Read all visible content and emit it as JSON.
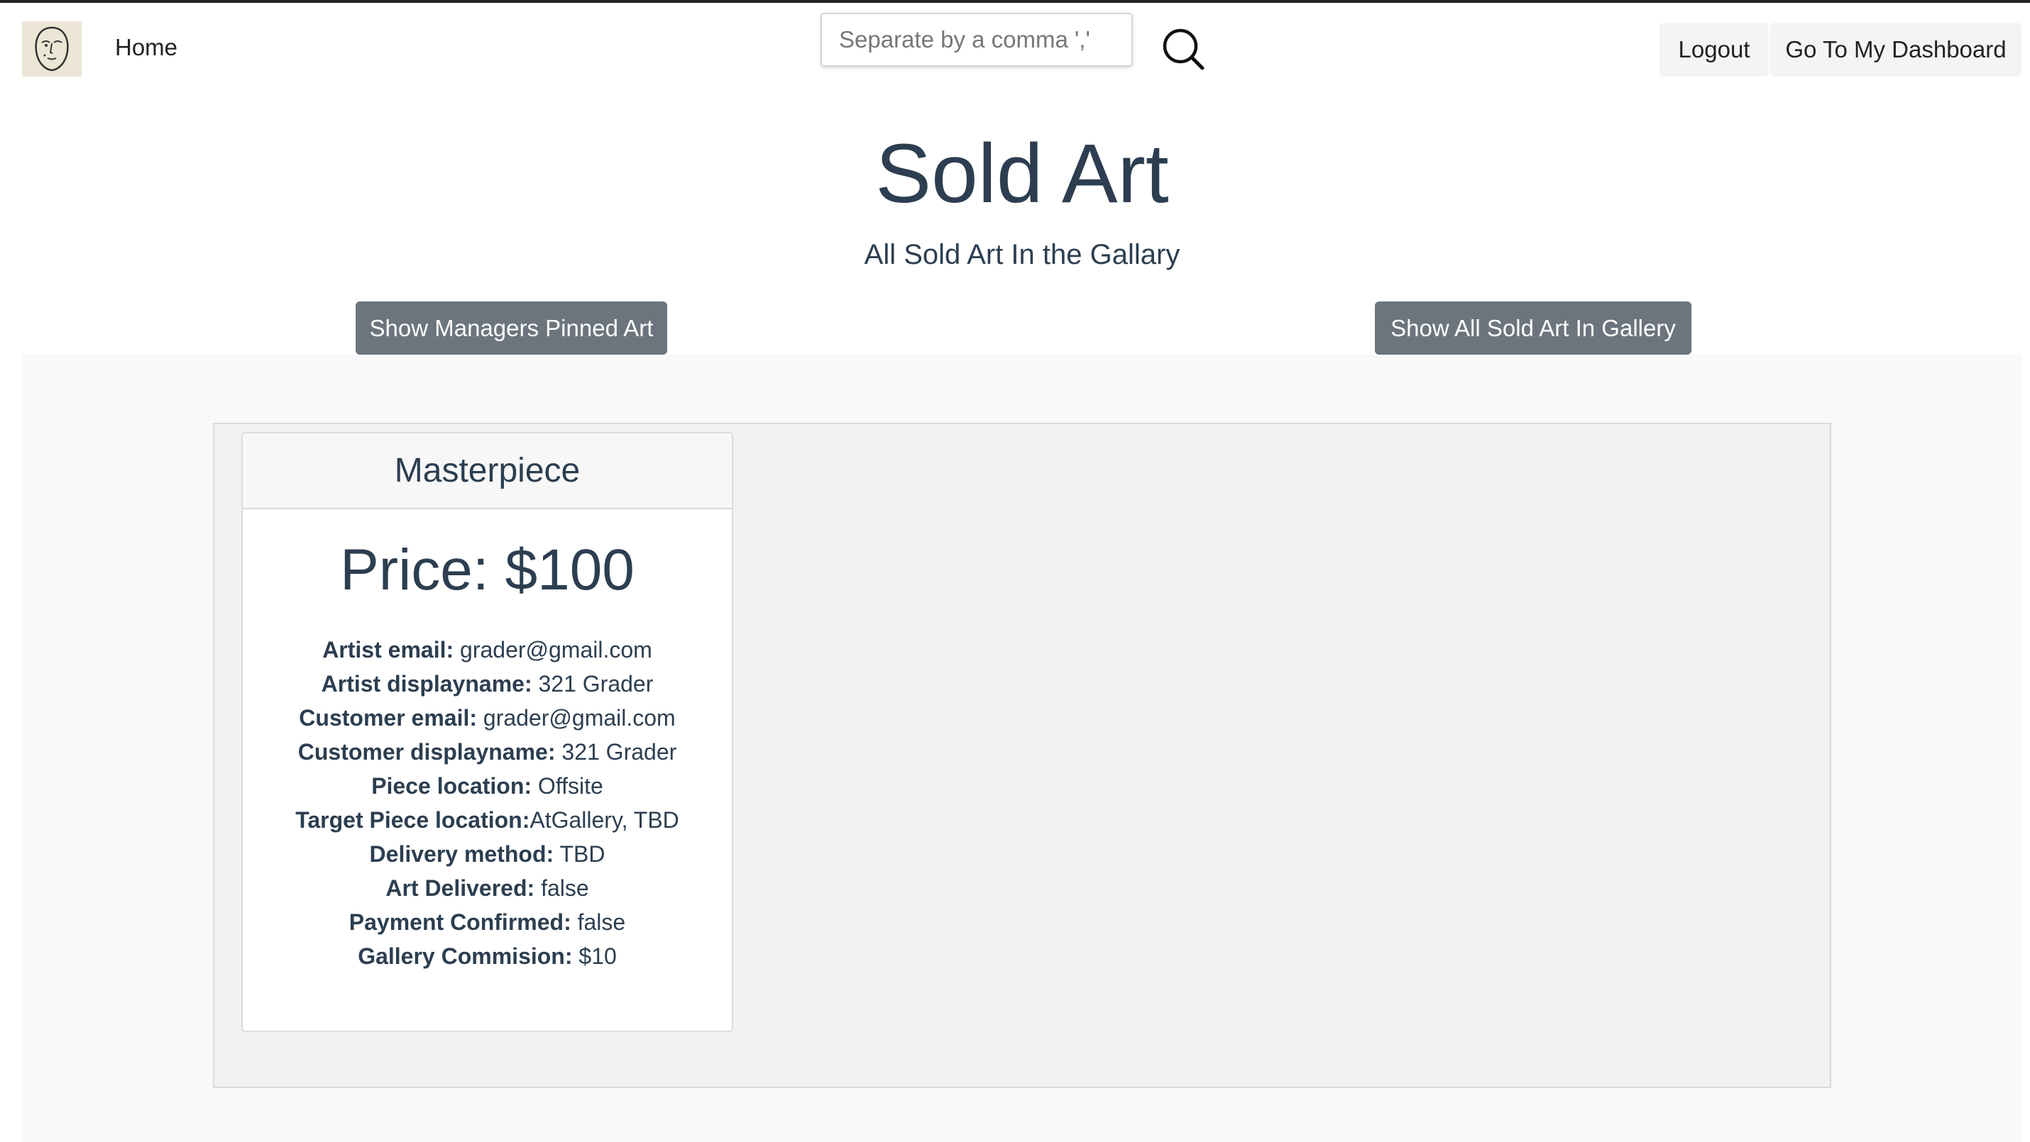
{
  "nav": {
    "home_label": "Home",
    "search_placeholder": "Separate by a comma ','",
    "logout_label": "Logout",
    "dashboard_label": "Go To My Dashboard"
  },
  "header": {
    "title": "Sold Art",
    "subtitle": "All Sold Art In the Gallary"
  },
  "actions": {
    "pinned_label": "Show Managers Pinned Art",
    "all_label": "Show All Sold Art In Gallery"
  },
  "card": {
    "title": "Masterpiece",
    "price": "Price: $100",
    "details": [
      {
        "label": "Artist email:",
        "value": " grader@gmail.com"
      },
      {
        "label": "Artist displayname:",
        "value": " 321 Grader"
      },
      {
        "label": "Customer email:",
        "value": " grader@gmail.com"
      },
      {
        "label": "Customer displayname:",
        "value": " 321 Grader"
      },
      {
        "label": "Piece location:",
        "value": " Offsite"
      },
      {
        "label": "Target Piece location:",
        "value": "AtGallery, TBD"
      },
      {
        "label": "Delivery method:",
        "value": " TBD"
      },
      {
        "label": "Art Delivered:",
        "value": " false"
      },
      {
        "label": "Payment Confirmed:",
        "value": " false"
      },
      {
        "label": "Gallery Commision:",
        "value": " $10"
      }
    ]
  },
  "icons": {
    "logo": "face-logo-icon",
    "search": "search-icon"
  },
  "colors": {
    "text": "#2c3e50",
    "secondary_button": "#6c757d",
    "content_bg": "#f8f9fa",
    "gallery_bg": "#f1f1f1"
  }
}
